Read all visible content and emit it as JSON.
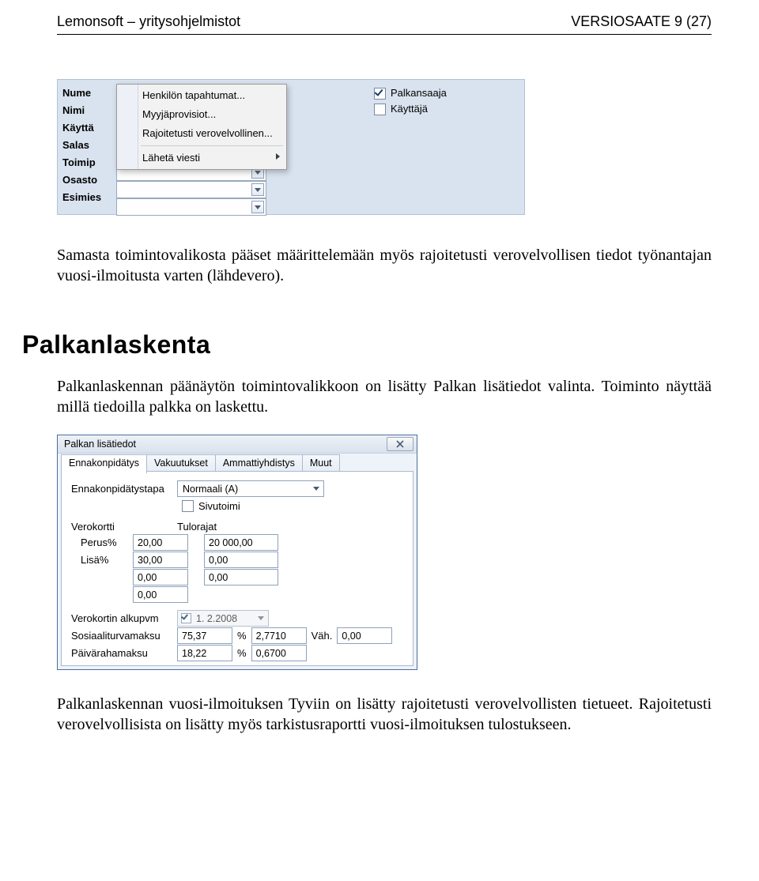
{
  "header": {
    "left": "Lemonsoft – yritysohjelmistot",
    "right": "VERSIOSAATE  9 (27)"
  },
  "shot1": {
    "labels": [
      "Nume",
      "Nimi",
      "Käyttä",
      "Salas",
      "Toimip",
      "Osasto",
      "Esimies"
    ],
    "menu": {
      "items": [
        "Henkilön tapahtumat...",
        "Myyjäprovisiot...",
        "Rajoitetusti verovelvollinen..."
      ],
      "separator_then": "Lähetä viesti"
    },
    "checkboxes": {
      "palkansaaja": "Palkansaaja",
      "kayttaja": "Käyttäjä"
    }
  },
  "para1": "Samasta toimintovalikosta pääset määrittelemään myös rajoitetusti verovelvollisen tiedot työnantajan vuosi-ilmoitusta varten (lähdevero).",
  "h2": "Palkanlaskenta",
  "para2": "Palkanlaskennan päänäytön toimintovalikkoon on lisätty Palkan lisätiedot valinta. Toiminto näyttää millä tiedoilla palkka on laskettu.",
  "shot2": {
    "title": "Palkan lisätiedot",
    "tabs": [
      "Ennakonpidätys",
      "Vakuutukset",
      "Ammattiyhdistys",
      "Muut"
    ],
    "fields": {
      "ekptapa_label": "Ennakonpidätystapa",
      "ekptapa_value": "Normaali (A)",
      "sivutoimi": "Sivutoimi",
      "verokortti": "Verokortti",
      "tulorajat": "Tulorajat",
      "perus": "Perus%",
      "lisa": "Lisä%",
      "alkupvm_label": "Verokortin alkupvm",
      "alkupvm_value": "1.  2.2008",
      "sotu_label": "Sosiaaliturvamaksu",
      "paiva_label": "Päivärahamaksu",
      "pct": "%",
      "vah": "Väh."
    },
    "values": {
      "perus_pct": "20,00",
      "perus_raja": "20 000,00",
      "lisa_pct": "30,00",
      "lisa_raja": "0,00",
      "row3_pct": "0,00",
      "row3_raja": "0,00",
      "row4_pct": "0,00",
      "sotu_pct": "75,37",
      "sotu_val": "2,7710",
      "sotu_vah": "0,00",
      "paiva_pct": "18,22",
      "paiva_val": "0,6700"
    }
  },
  "para3": "Palkanlaskennan vuosi-ilmoituksen Tyviin on lisätty rajoitetusti verovelvollisten tietueet. Rajoitetusti verovelvollisista on lisätty myös tarkistusraportti vuosi-ilmoituksen tulostukseen."
}
